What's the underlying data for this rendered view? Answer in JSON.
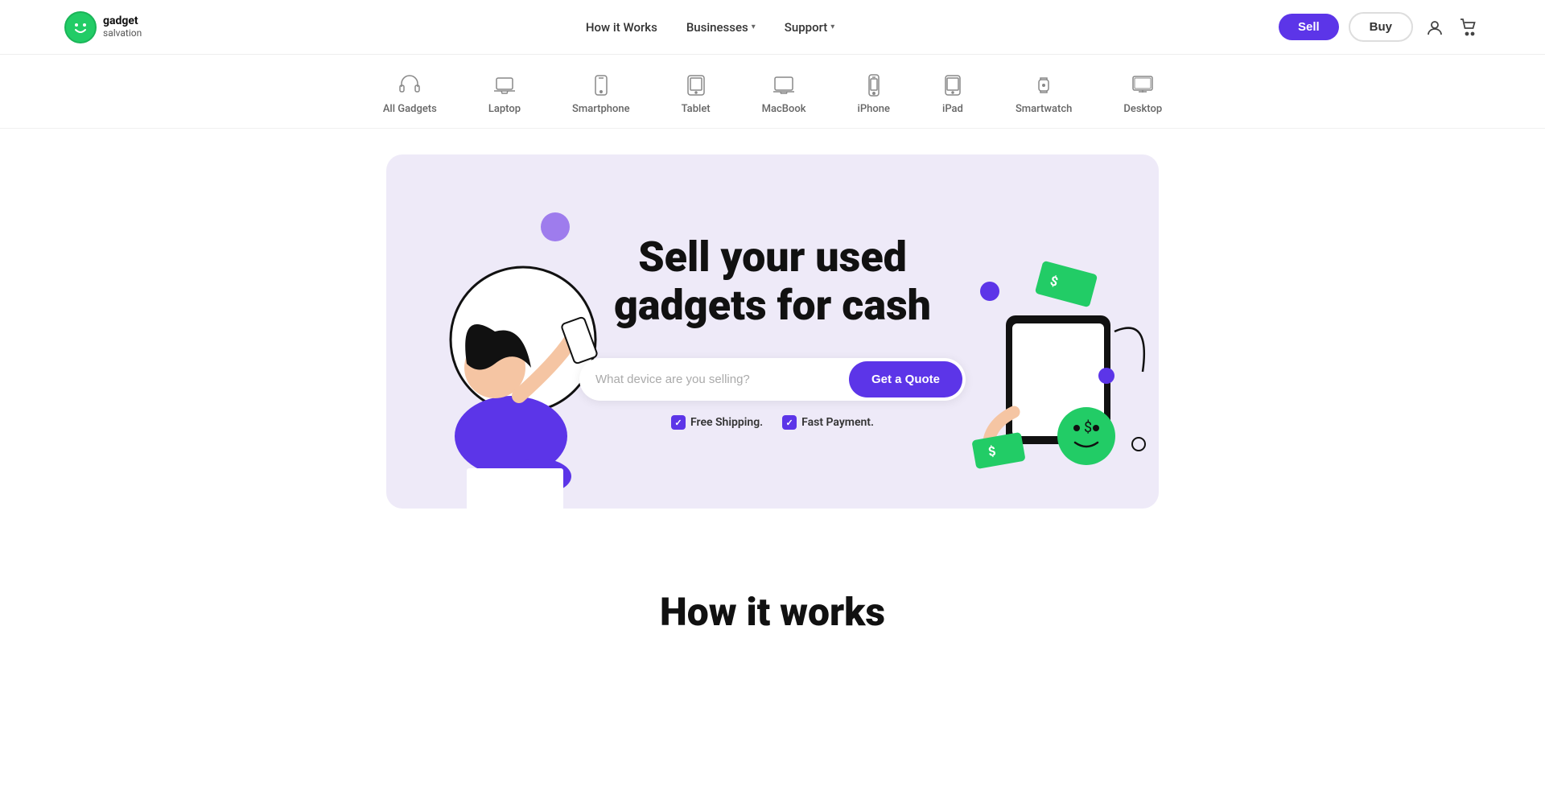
{
  "brand": {
    "name_line1": "gadget",
    "name_line2": "salvation",
    "logo_alt": "Gadget Salvation Logo"
  },
  "nav": {
    "items": [
      {
        "id": "how-it-works",
        "label": "How it Works",
        "has_dropdown": false
      },
      {
        "id": "businesses",
        "label": "Businesses",
        "has_dropdown": true
      },
      {
        "id": "support",
        "label": "Support",
        "has_dropdown": true
      }
    ],
    "sell_label": "Sell",
    "buy_label": "Buy"
  },
  "categories": [
    {
      "id": "all-gadgets",
      "label": "All Gadgets",
      "icon": "headphones"
    },
    {
      "id": "laptop",
      "label": "Laptop",
      "icon": "laptop"
    },
    {
      "id": "smartphone",
      "label": "Smartphone",
      "icon": "smartphone"
    },
    {
      "id": "tablet",
      "label": "Tablet",
      "icon": "tablet"
    },
    {
      "id": "macbook",
      "label": "MacBook",
      "icon": "macbook"
    },
    {
      "id": "iphone",
      "label": "iPhone",
      "icon": "iphone"
    },
    {
      "id": "ipad",
      "label": "iPad",
      "icon": "ipad"
    },
    {
      "id": "smartwatch",
      "label": "Smartwatch",
      "icon": "smartwatch"
    },
    {
      "id": "desktop",
      "label": "Desktop",
      "icon": "desktop"
    }
  ],
  "hero": {
    "title_line1": "Sell your used",
    "title_line2": "gadgets for cash",
    "search_placeholder": "What device are you selling?",
    "cta_label": "Get a Quote",
    "perks": [
      {
        "id": "shipping",
        "label": "Free Shipping."
      },
      {
        "id": "payment",
        "label": "Fast Payment."
      }
    ]
  },
  "how_it_works": {
    "title": "How it works"
  },
  "colors": {
    "accent": "#5c35e8",
    "accent_light": "#eeeaf8",
    "green_deco": "#22cc66"
  }
}
